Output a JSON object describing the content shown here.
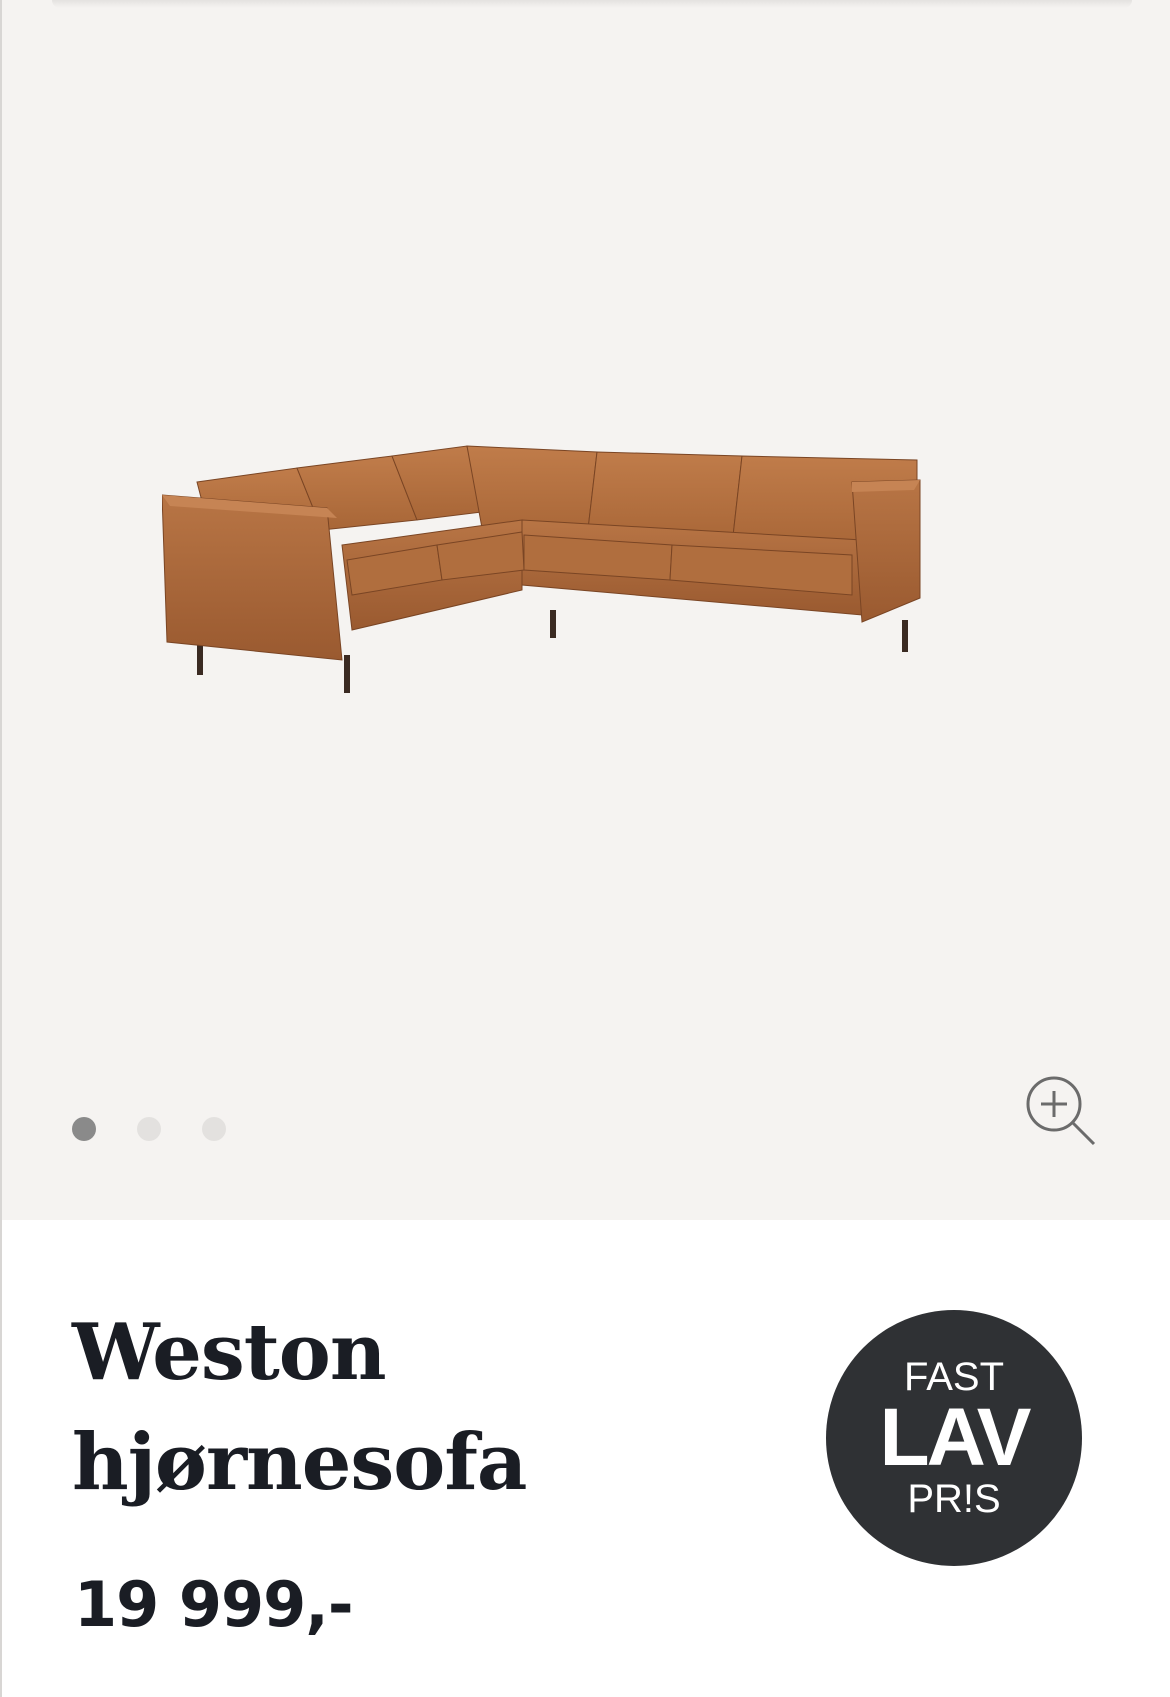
{
  "gallery": {
    "image_alt": "Weston hjørnesofa",
    "dots": [
      "slide-1",
      "slide-2",
      "slide-3"
    ],
    "active_index": 0,
    "zoom_icon": "zoom-in-icon",
    "background": "#f5f3f1"
  },
  "product": {
    "title_line1": "Weston",
    "title_line2": "hjørnesofa",
    "price": "19 999,-"
  },
  "badge": {
    "line1": "FAST",
    "line2": "LAV",
    "line3": "PR!S",
    "color": "#2f3134"
  },
  "colors": {
    "text": "#1a1d24",
    "sofa": "#a8673a"
  }
}
